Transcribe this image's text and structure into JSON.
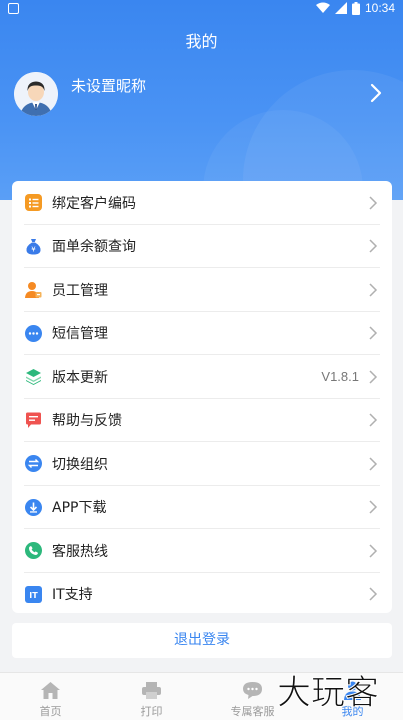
{
  "status_bar": {
    "time": "10:34"
  },
  "header": {
    "title": "我的"
  },
  "profile": {
    "nickname": "未设置昵称"
  },
  "menu": [
    {
      "label": "绑定客户编码",
      "icon": "clipboard-list-icon",
      "color": "#f59a23",
      "value": ""
    },
    {
      "label": "面单余额查询",
      "icon": "money-bag-icon",
      "color": "#3a7be8",
      "value": ""
    },
    {
      "label": "员工管理",
      "icon": "staff-person-icon",
      "color": "#f58a23",
      "value": ""
    },
    {
      "label": "短信管理",
      "icon": "message-dots-icon",
      "color": "#3a86f0",
      "value": ""
    },
    {
      "label": "版本更新",
      "icon": "layers-icon",
      "color": "#2db87c",
      "value": "V1.8.1"
    },
    {
      "label": "帮助与反馈",
      "icon": "feedback-icon",
      "color": "#ef5350",
      "value": ""
    },
    {
      "label": "切换组织",
      "icon": "switch-arrows-icon",
      "color": "#3a86f0",
      "value": ""
    },
    {
      "label": "APP下载",
      "icon": "download-icon",
      "color": "#3a86f0",
      "value": ""
    },
    {
      "label": "客服热线",
      "icon": "phone-icon",
      "color": "#2db87c",
      "value": ""
    },
    {
      "label": "IT支持",
      "icon": "it-badge-icon",
      "color": "#3a86f0",
      "value": ""
    }
  ],
  "logout_label": "退出登录",
  "tabs": [
    {
      "label": "首页",
      "icon": "home-icon",
      "active": false
    },
    {
      "label": "打印",
      "icon": "printer-icon",
      "active": false
    },
    {
      "label": "专属客服",
      "icon": "chat-bubble-icon",
      "active": false
    },
    {
      "label": "我的",
      "icon": "user-icon",
      "active": true
    }
  ],
  "watermark": {
    "text": "大玩客"
  },
  "colors": {
    "accent": "#3a86f0",
    "background": "#f2f3f5",
    "hero_gradient_top": "#3a86f0",
    "hero_gradient_bottom": "#5a9ff6"
  }
}
